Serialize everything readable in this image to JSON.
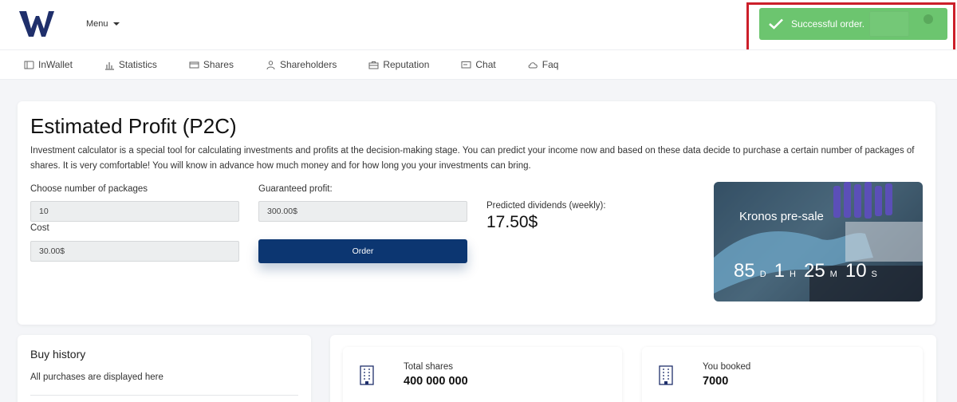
{
  "header": {
    "logo_letter": "W",
    "menu_label": "Menu"
  },
  "toast": {
    "message": "Successful order."
  },
  "nav": [
    {
      "label": "InWallet",
      "icon": "wallet-icon"
    },
    {
      "label": "Statistics",
      "icon": "bar-chart-icon"
    },
    {
      "label": "Shares",
      "icon": "card-icon"
    },
    {
      "label": "Shareholders",
      "icon": "users-icon"
    },
    {
      "label": "Reputation",
      "icon": "briefcase-icon"
    },
    {
      "label": "Chat",
      "icon": "chat-icon"
    },
    {
      "label": "Faq",
      "icon": "cloud-icon"
    }
  ],
  "calculator": {
    "title": "Estimated Profit (P2C)",
    "description": "Investment calculator is a special tool for calculating investments and profits at the decision-making stage. You can predict your income now and based on these data decide to purchase a certain number of packages of shares. It is very comfortable! You will know in advance how much money and for how long you your investments can bring.",
    "packages_label": "Choose number of packages",
    "packages_value": "10",
    "cost_label": "Cost",
    "cost_value": "30.00$",
    "guaranteed_label": "Guaranteed profit:",
    "guaranteed_value": "300.00$",
    "order_label": "Order",
    "dividends_label": "Predicted dividends (weekly):",
    "dividends_value": "17.50$"
  },
  "promo": {
    "title": "Kronos pre-sale",
    "days": "85",
    "days_unit": "D",
    "hours": "1",
    "hours_unit": "H",
    "minutes": "25",
    "minutes_unit": "M",
    "seconds": "10",
    "seconds_unit": "S"
  },
  "history": {
    "title": "Buy history",
    "subtitle": "All purchases are displayed here"
  },
  "stats": [
    {
      "label": "Total shares",
      "value": "400 000 000",
      "icon": "building-icon"
    },
    {
      "label": "You booked",
      "value": "7000",
      "icon": "building-icon"
    }
  ],
  "colors": {
    "brand": "#1f2f6b",
    "order_button": "#0c3671",
    "toast_success": "#6cc56f",
    "highlight_frame": "#cc1f2a"
  }
}
